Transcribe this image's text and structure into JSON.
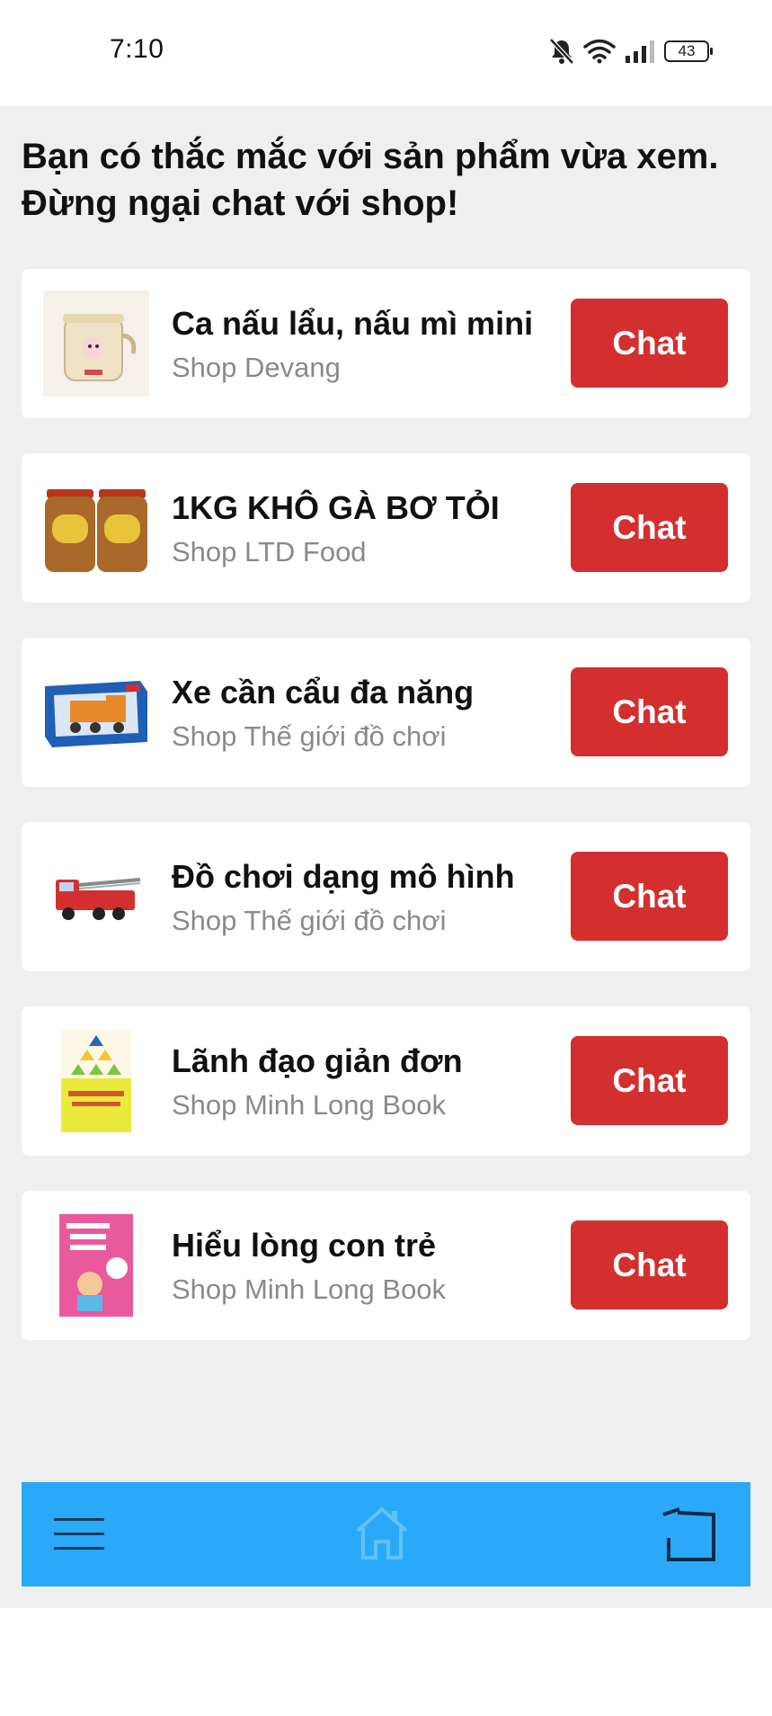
{
  "status_bar": {
    "time": "7:10",
    "battery": "43",
    "icons": [
      "bell-off-icon",
      "wifi-icon",
      "signal-icon",
      "battery-icon"
    ]
  },
  "headline": "Bạn có thắc mắc với sản phẩm vừa xem.\nĐừng ngại chat với shop!",
  "products": [
    {
      "title": "Ca nấu lẩu, nấu mì mini",
      "shop": "Shop Devang",
      "chat_label": "Chat",
      "thumb": "cooker"
    },
    {
      "title": "1KG KHÔ GÀ BƠ TỎI",
      "shop": "Shop LTD Food",
      "chat_label": "Chat",
      "thumb": "jars"
    },
    {
      "title": "Xe cần cẩu đa năng",
      "shop": "Shop Thế giới đồ chơi",
      "chat_label": "Chat",
      "thumb": "crane-box"
    },
    {
      "title": "Đồ chơi dạng mô hình",
      "shop": "Shop Thế giới đồ chơi",
      "chat_label": "Chat",
      "thumb": "firetruck"
    },
    {
      "title": "Lãnh đạo giản đơn",
      "shop": "Shop Minh Long Book",
      "chat_label": "Chat",
      "thumb": "book-yellow"
    },
    {
      "title": "Hiểu lòng con trẻ",
      "shop": "Shop Minh Long Book",
      "chat_label": "Chat",
      "thumb": "book-pink"
    }
  ],
  "bottom_nav": {
    "icons": [
      "menu-icon",
      "home-icon",
      "back-icon"
    ]
  },
  "colors": {
    "accent_red": "#d32f2f",
    "nav_blue": "#2aa9f8",
    "background": "#efefef"
  }
}
